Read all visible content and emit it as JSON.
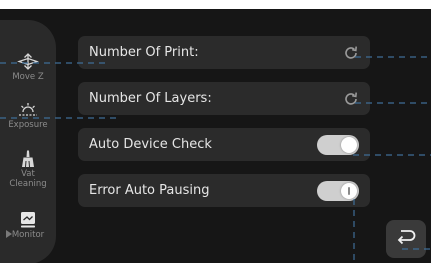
{
  "sidebar": {
    "items": [
      {
        "label": "Move Z",
        "icon": "move-z-icon"
      },
      {
        "label": "Exposure",
        "icon": "exposure-icon"
      },
      {
        "label": "Vat Cleaning",
        "icon": "vat-cleaning-icon"
      },
      {
        "label": "Monitor",
        "icon": "monitor-icon"
      }
    ],
    "active": "Monitor"
  },
  "settings": {
    "number_of_print": {
      "label": "Number Of Print:",
      "action_icon": "refresh-icon"
    },
    "number_of_layers": {
      "label": "Number Of Layers:",
      "action_icon": "refresh-icon"
    },
    "auto_device_check": {
      "label": "Auto Device Check",
      "enabled": true
    },
    "error_auto_pausing": {
      "label": "Error Auto Pausing",
      "enabled": true
    }
  },
  "back_button": {
    "icon": "return-arrow-icon"
  },
  "colors": {
    "background": "#161616",
    "row": "#2b2b2b",
    "sidebar": "#2a2a2a",
    "toggle_on": "#cfcfcf",
    "annotation_line": "#3f6e97"
  }
}
